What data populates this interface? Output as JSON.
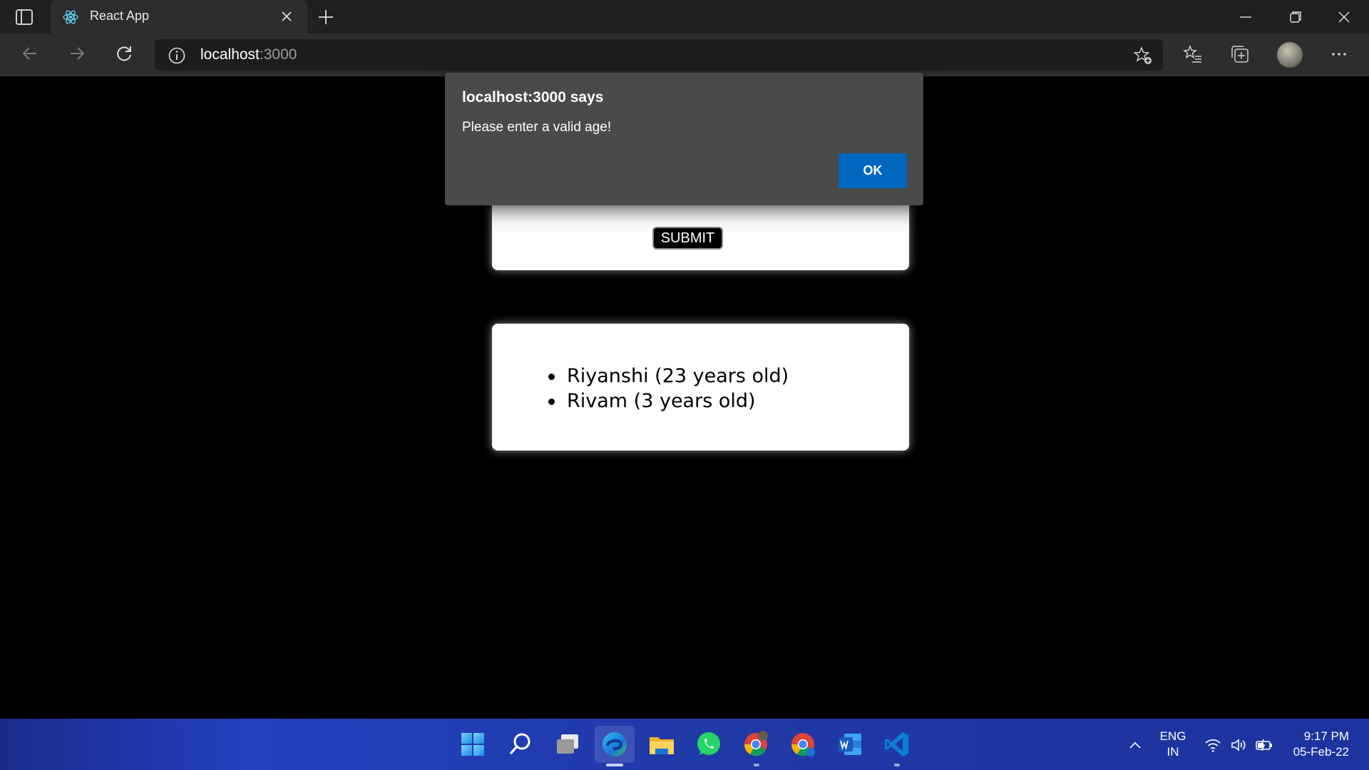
{
  "browser": {
    "tab_title": "React App",
    "url_host": "localhost",
    "url_port": ":3000"
  },
  "page": {
    "submit_label": "SUBMIT",
    "users": [
      "Riyanshi (23 years old)",
      "Rivam (3 years old)"
    ]
  },
  "dialog": {
    "title": "localhost:3000 says",
    "message": "Please enter a valid age!",
    "ok_label": "OK"
  },
  "taskbar": {
    "apps": [
      "start-icon",
      "search-icon",
      "task-view-icon",
      "edge-icon",
      "file-explorer-icon",
      "whatsapp-icon",
      "chrome-icon",
      "chrome-profile-icon",
      "word-icon",
      "vscode-icon"
    ],
    "lang_line1": "ENG",
    "lang_line2": "IN",
    "time": "9:17 PM",
    "date": "05-Feb-22"
  },
  "colors": {
    "accent": "#0067c0",
    "page_bg": "#000000",
    "dialog_bg": "#4a4a4a"
  }
}
